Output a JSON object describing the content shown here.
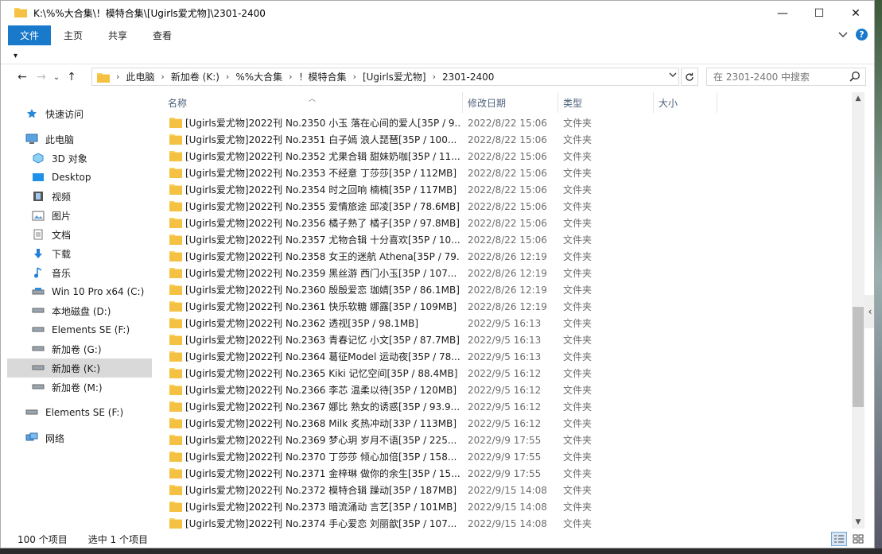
{
  "window": {
    "title": "K:\\%%大合集\\！模特合集\\[Ugirls爱尤物]\\2301-2400",
    "controls": {
      "minimize": "—",
      "maximize": "☐",
      "close": "✕"
    }
  },
  "ribbon": {
    "tabs": [
      "文件",
      "主页",
      "共享",
      "查看"
    ],
    "expand_icon": "chevron-down-icon",
    "help_label": "?"
  },
  "qat": {
    "dropdown_glyph": "▾"
  },
  "nav": {
    "back": "←",
    "forward": "→",
    "recent": "⌄",
    "up": "↑",
    "breadcrumb": [
      "此电脑",
      "新加卷 (K:)",
      "%%大合集",
      "！模特合集",
      "[Ugirls爱尤物]",
      "2301-2400"
    ],
    "search_placeholder": "在 2301-2400 中搜索"
  },
  "sidebar": {
    "items": [
      {
        "label": "快速访问",
        "icon": "star-icon",
        "selected": false
      },
      {
        "label": "此电脑",
        "icon": "computer-icon",
        "selected": false
      },
      {
        "label": "3D 对象",
        "icon": "cube-icon",
        "selected": false
      },
      {
        "label": "Desktop",
        "icon": "desktop-icon",
        "selected": false
      },
      {
        "label": "视频",
        "icon": "video-icon",
        "selected": false
      },
      {
        "label": "图片",
        "icon": "picture-icon",
        "selected": false
      },
      {
        "label": "文档",
        "icon": "document-icon",
        "selected": false
      },
      {
        "label": "下载",
        "icon": "download-icon",
        "selected": false
      },
      {
        "label": "音乐",
        "icon": "music-icon",
        "selected": false
      },
      {
        "label": "Win 10 Pro x64 (C:)",
        "icon": "drive-icon",
        "selected": false
      },
      {
        "label": "本地磁盘 (D:)",
        "icon": "drive-icon",
        "selected": false
      },
      {
        "label": "Elements SE (F:)",
        "icon": "drive-icon",
        "selected": false
      },
      {
        "label": "新加卷 (G:)",
        "icon": "drive-icon",
        "selected": false
      },
      {
        "label": "新加卷 (K:)",
        "icon": "drive-icon",
        "selected": true
      },
      {
        "label": "新加卷 (M:)",
        "icon": "drive-icon",
        "selected": false
      },
      {
        "label": "Elements SE (F:)",
        "icon": "drive-icon",
        "selected": false
      },
      {
        "label": "网络",
        "icon": "network-icon",
        "selected": false
      }
    ]
  },
  "columns": {
    "name": "名称",
    "date": "修改日期",
    "type": "类型",
    "size": "大小"
  },
  "files": [
    {
      "name": "[Ugirls爱尤物]2022刊 No.2350 小玉 落在心间的爱人[35P / 9...",
      "date": "2022/8/22 15:06",
      "type": "文件夹"
    },
    {
      "name": "[Ugirls爱尤物]2022刊 No.2351 白子嫣 浪人琵琶[35P / 100...",
      "date": "2022/8/22 15:06",
      "type": "文件夹"
    },
    {
      "name": "[Ugirls爱尤物]2022刊 No.2352 尤果合辑 甜妹奶咖[35P / 11...",
      "date": "2022/8/22 15:06",
      "type": "文件夹"
    },
    {
      "name": "[Ugirls爱尤物]2022刊 No.2353 不经意 丁莎莎[35P / 112MB]",
      "date": "2022/8/22 15:06",
      "type": "文件夹"
    },
    {
      "name": "[Ugirls爱尤物]2022刊 No.2354 时之回响 楠楠[35P / 117MB]",
      "date": "2022/8/22 15:06",
      "type": "文件夹"
    },
    {
      "name": "[Ugirls爱尤物]2022刊 No.2355 爱情旅途 邱凌[35P / 78.6MB]",
      "date": "2022/8/22 15:06",
      "type": "文件夹"
    },
    {
      "name": "[Ugirls爱尤物]2022刊 No.2356 橘子熟了 橘子[35P / 97.8MB]",
      "date": "2022/8/22 15:06",
      "type": "文件夹"
    },
    {
      "name": "[Ugirls爱尤物]2022刊 No.2357 尤物合辑 十分喜欢[35P / 10...",
      "date": "2022/8/22 15:06",
      "type": "文件夹"
    },
    {
      "name": "[Ugirls爱尤物]2022刊 No.2358 女王的迷航 Athena[35P / 79...",
      "date": "2022/8/26 12:19",
      "type": "文件夹"
    },
    {
      "name": "[Ugirls爱尤物]2022刊 No.2359 黑丝游 西门小玉[35P / 107...",
      "date": "2022/8/26 12:19",
      "type": "文件夹"
    },
    {
      "name": "[Ugirls爱尤物]2022刊 No.2360 殷殷爱恋 珈婧[35P / 86.1MB]",
      "date": "2022/8/26 12:19",
      "type": "文件夹"
    },
    {
      "name": "[Ugirls爱尤物]2022刊 No.2361 快乐软糖 娜露[35P / 109MB]",
      "date": "2022/8/26 12:19",
      "type": "文件夹"
    },
    {
      "name": "[Ugirls爱尤物]2022刊 No.2362 透视[35P / 98.1MB]",
      "date": "2022/9/5 16:13",
      "type": "文件夹"
    },
    {
      "name": "[Ugirls爱尤物]2022刊 No.2363 青春记忆 小文[35P / 87.7MB]",
      "date": "2022/9/5 16:13",
      "type": "文件夹"
    },
    {
      "name": "[Ugirls爱尤物]2022刊 No.2364 葛征Model 运动夜[35P / 78....",
      "date": "2022/9/5 16:13",
      "type": "文件夹"
    },
    {
      "name": "[Ugirls爱尤物]2022刊 No.2365 Kiki 记忆空间[35P / 88.4MB]",
      "date": "2022/9/5 16:12",
      "type": "文件夹"
    },
    {
      "name": "[Ugirls爱尤物]2022刊 No.2366 李芯 温柔以待[35P / 120MB]",
      "date": "2022/9/5 16:12",
      "type": "文件夹"
    },
    {
      "name": "[Ugirls爱尤物]2022刊 No.2367 娜比 熟女的诱惑[35P / 93.9...",
      "date": "2022/9/5 16:12",
      "type": "文件夹"
    },
    {
      "name": "[Ugirls爱尤物]2022刊 No.2368 Milk 炙热冲动[33P / 113MB]",
      "date": "2022/9/5 16:12",
      "type": "文件夹"
    },
    {
      "name": "[Ugirls爱尤物]2022刊 No.2369 梦心玥 岁月不语[35P / 225...",
      "date": "2022/9/9 17:55",
      "type": "文件夹"
    },
    {
      "name": "[Ugirls爱尤物]2022刊 No.2370 丁莎莎 倾心加倍[35P / 158...",
      "date": "2022/9/9 17:55",
      "type": "文件夹"
    },
    {
      "name": "[Ugirls爱尤物]2022刊 No.2371 金梓琳 做你的余生[35P / 15...",
      "date": "2022/9/9 17:55",
      "type": "文件夹"
    },
    {
      "name": "[Ugirls爱尤物]2022刊 No.2372 模特合辑 躁动[35P / 187MB]",
      "date": "2022/9/15 14:08",
      "type": "文件夹"
    },
    {
      "name": "[Ugirls爱尤物]2022刊 No.2373 暗流涌动 言艺[35P / 101MB]",
      "date": "2022/9/15 14:08",
      "type": "文件夹"
    },
    {
      "name": "[Ugirls爱尤物]2022刊 No.2374 手心爱恋 刘丽歆[35P / 107...",
      "date": "2022/9/15 14:08",
      "type": "文件夹"
    }
  ],
  "status": {
    "item_count": "100 个项目",
    "selected": "选中 1 个项目"
  },
  "colors": {
    "accent": "#1979ca",
    "folder": "#f7cf5a",
    "selected_nav": "#d9d9d9"
  }
}
